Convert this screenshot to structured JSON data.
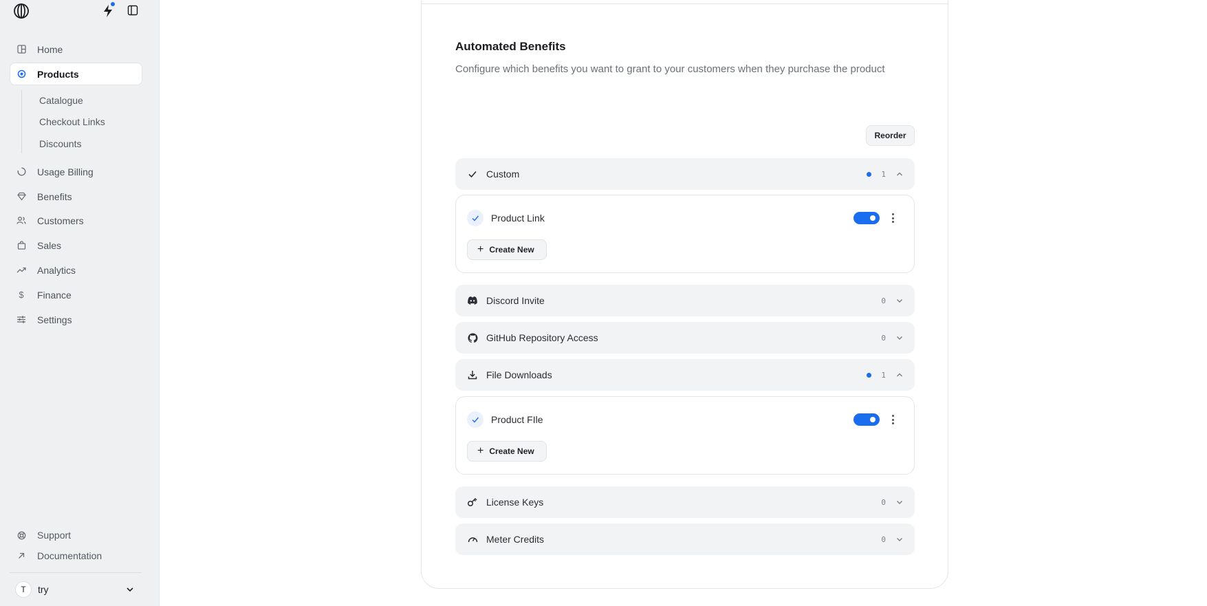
{
  "sidebar": {
    "nav": [
      {
        "label": "Home",
        "icon": "home-grid-icon"
      },
      {
        "label": "Products",
        "icon": "products-icon",
        "active": true
      },
      {
        "label": "Usage Billing",
        "icon": "usage-billing-icon"
      },
      {
        "label": "Benefits",
        "icon": "diamond-icon"
      },
      {
        "label": "Customers",
        "icon": "users-icon"
      },
      {
        "label": "Sales",
        "icon": "shopping-bag-icon"
      },
      {
        "label": "Analytics",
        "icon": "trend-icon"
      },
      {
        "label": "Finance",
        "icon": "dollar-icon"
      },
      {
        "label": "Settings",
        "icon": "sliders-icon"
      }
    ],
    "sub_items": [
      "Catalogue",
      "Checkout Links",
      "Discounts"
    ],
    "bottom": [
      {
        "label": "Support",
        "icon": "lifebuoy-icon"
      },
      {
        "label": "Documentation",
        "icon": "external-arrow-icon"
      }
    ],
    "user": {
      "initial": "T",
      "name": "try"
    }
  },
  "benefits": {
    "title": "Automated Benefits",
    "description": "Configure which benefits you want to grant to your customers when they purchase the product",
    "reorder_label": "Reorder",
    "groups": [
      {
        "label": "Custom",
        "count": "1",
        "expanded": true,
        "item": "Product Link",
        "create_label": "Create New"
      },
      {
        "label": "Discord Invite",
        "count": "0",
        "expanded": false
      },
      {
        "label": "GitHub Repository Access",
        "count": "0",
        "expanded": false
      },
      {
        "label": "File Downloads",
        "count": "1",
        "expanded": true,
        "item": "Product FIle",
        "create_label": "Create New"
      },
      {
        "label": "License Keys",
        "count": "0",
        "expanded": false
      },
      {
        "label": "Meter Credits",
        "count": "0",
        "expanded": false
      }
    ]
  },
  "colors": {
    "accent": "#1b6df0",
    "sidebar_bg": "#eef0f2"
  }
}
